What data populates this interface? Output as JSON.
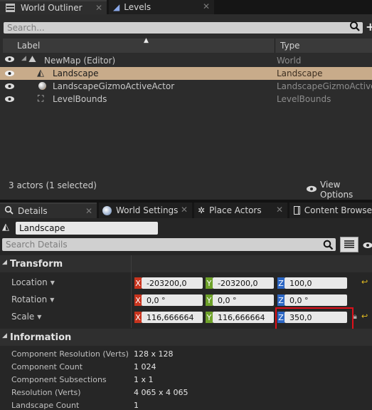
{
  "outliner": {
    "tab_title": "World Outliner",
    "levels_tab": "Levels",
    "search_placeholder": "Search...",
    "col_label": "Label",
    "col_type": "Type",
    "rows": [
      {
        "label": "NewMap (Editor)",
        "type": "World"
      },
      {
        "label": "Landscape",
        "type": "Landscape"
      },
      {
        "label": "LandscapeGizmoActiveActor",
        "type": "LandscapeGizmoActiveA"
      },
      {
        "label": "LevelBounds",
        "type": "LevelBounds"
      }
    ],
    "actor_count": "3 actors (1 selected)",
    "view_options": "View Options"
  },
  "details": {
    "tabs": [
      "Details",
      "World Settings",
      "Place Actors",
      "Content Browse"
    ],
    "actor_name": "Landscape",
    "search_placeholder": "Search Details",
    "transform_title": "Transform",
    "location_label": "Location",
    "rotation_label": "Rotation",
    "scale_label": "Scale",
    "axis": {
      "x": "X",
      "y": "Y",
      "z": "Z"
    },
    "location": {
      "x": "-203200,0",
      "y": "-203200,0",
      "z": "100,0"
    },
    "rotation": {
      "x": "0,0 °",
      "y": "0,0 °",
      "z": "0,0 °"
    },
    "scale": {
      "x": "116,666664",
      "y": "116,666664",
      "z": "350,0"
    },
    "information_title": "Information",
    "info": [
      {
        "label": "Component Resolution (Verts)",
        "value": "128 x 128"
      },
      {
        "label": "Component Count",
        "value": "1 024"
      },
      {
        "label": "Component Subsections",
        "value": "1 x 1"
      },
      {
        "label": "Resolution (Verts)",
        "value": "4 065 x 4 065"
      },
      {
        "label": "Landscape Count",
        "value": "1"
      }
    ]
  },
  "colors": {
    "highlight": "#e0101a",
    "selection": "#c8ab8a"
  }
}
